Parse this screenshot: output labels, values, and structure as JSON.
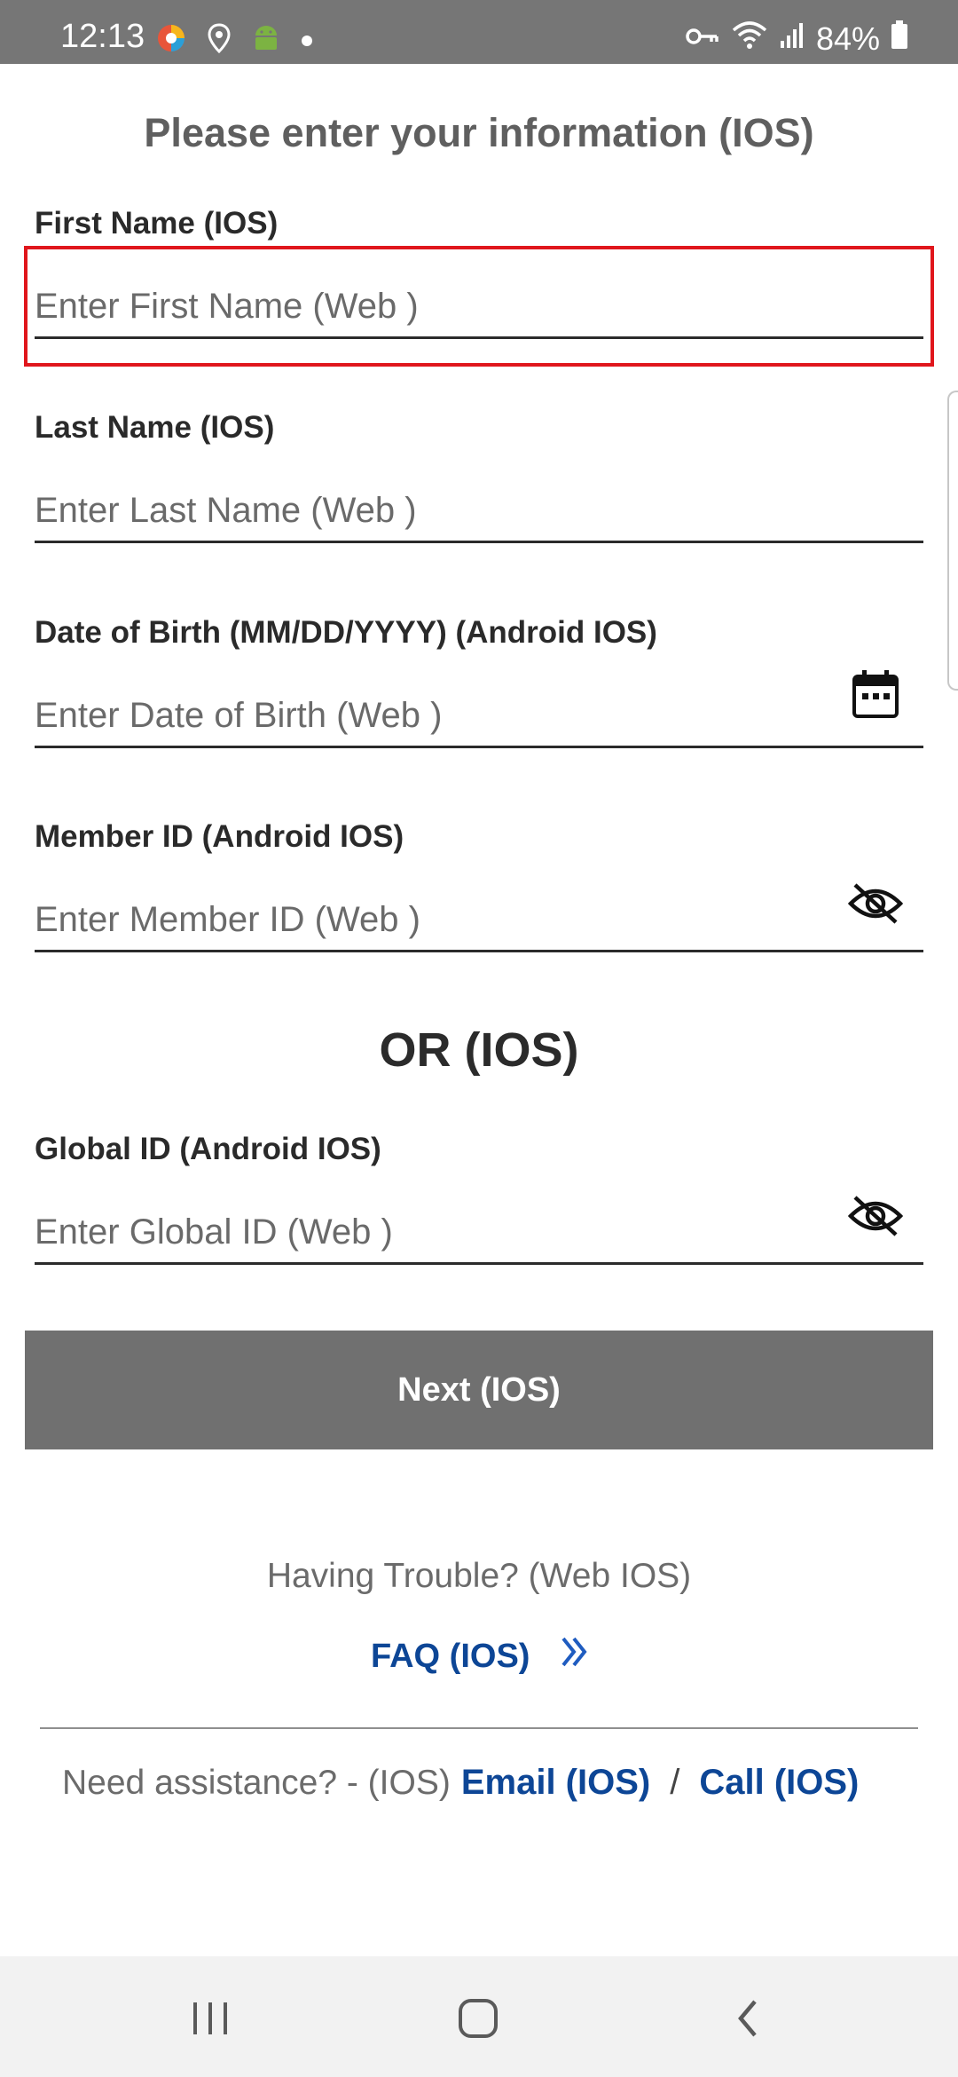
{
  "status_bar": {
    "time": "12:13",
    "battery": "84%",
    "icons": [
      "browser-icon",
      "location-icon",
      "android-icon",
      "notification-dot",
      "vpn-key-icon",
      "wifi-icon",
      "signal-icon",
      "battery-icon"
    ]
  },
  "page_title": "Please enter your information (IOS)",
  "form": {
    "first_name": {
      "label": "First Name (IOS)",
      "placeholder": "Enter First Name (Web )"
    },
    "last_name": {
      "label": "Last Name (IOS)",
      "placeholder": "Enter Last Name (Web )"
    },
    "dob": {
      "label": "Date of Birth (MM/DD/YYYY) (Android IOS)",
      "placeholder": "Enter Date of Birth (Web )",
      "icon": "calendar-icon"
    },
    "member_id": {
      "label": "Member ID (Android IOS)",
      "placeholder": "Enter Member ID (Web )",
      "icon": "eye-off-icon"
    },
    "or_text": "OR (IOS)",
    "global_id": {
      "label": "Global ID (Android IOS)",
      "placeholder": "Enter Global ID (Web )",
      "icon": "eye-off-icon"
    }
  },
  "next_button": "Next (IOS)",
  "help": {
    "trouble": "Having Trouble? (Web IOS)",
    "faq": "FAQ (IOS)",
    "assistance": "Need assistance? - (IOS)",
    "email": "Email (IOS)",
    "separator": "/",
    "call": "Call (IOS)"
  },
  "colors": {
    "link": "#0d4696",
    "highlight": "#e0161c",
    "button": "#707070",
    "status_bar": "#767676"
  },
  "nav_bar": {
    "buttons": [
      "recents-icon",
      "home-icon",
      "back-icon"
    ]
  }
}
